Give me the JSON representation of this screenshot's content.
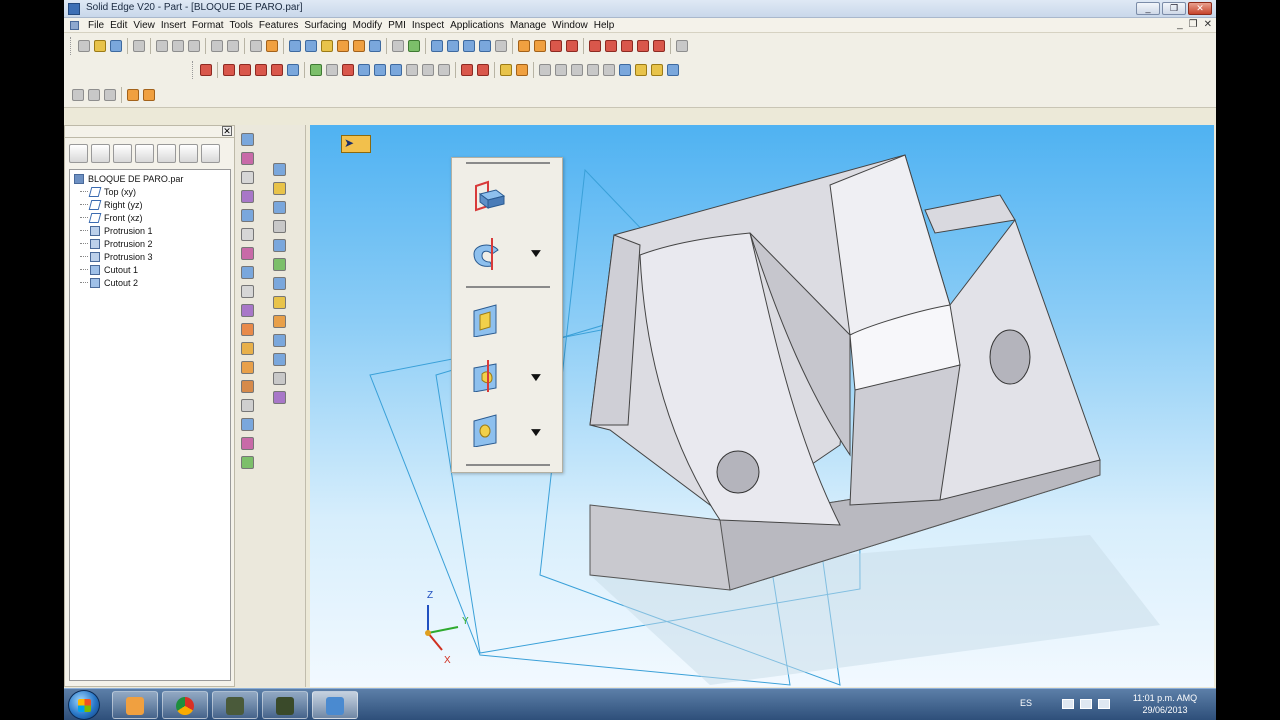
{
  "window": {
    "title": "Solid Edge V20 - Part - [BLOQUE DE PARO.par]",
    "minimize": "_",
    "restore": "❐",
    "close": "✕"
  },
  "menu": {
    "items": [
      "File",
      "Edit",
      "View",
      "Insert",
      "Format",
      "Tools",
      "Features",
      "Surfacing",
      "Modify",
      "PMI",
      "Inspect",
      "Applications",
      "Manage",
      "Window",
      "Help"
    ],
    "mdi_controls": [
      "_",
      "❐",
      "✕"
    ]
  },
  "pathfinder": {
    "close_glyph": "✕",
    "root": "BLOQUE DE PARO.par",
    "items": [
      {
        "label": "Top (xy)",
        "icon": "plane-icon"
      },
      {
        "label": "Right (yz)",
        "icon": "plane-icon"
      },
      {
        "label": "Front (xz)",
        "icon": "plane-icon"
      },
      {
        "label": "Protrusion 1",
        "icon": "protrusion-icon"
      },
      {
        "label": "Protrusion 2",
        "icon": "protrusion-icon"
      },
      {
        "label": "Protrusion 3",
        "icon": "protrusion-icon"
      },
      {
        "label": "Cutout 1",
        "icon": "cutout-icon"
      },
      {
        "label": "Cutout 2",
        "icon": "cutout-icon"
      }
    ]
  },
  "triad": {
    "x": "X",
    "y": "Y",
    "z": "Z"
  },
  "palette": {
    "carets": [
      "▼",
      "▼",
      "▼"
    ]
  },
  "taskbar": {
    "language": "ES",
    "time": "11:01 p.m. AMQ",
    "date": "29/06/2013"
  },
  "colors": {
    "viewport_top": "#4fb2f2",
    "viewport_bottom": "#f2f9ff",
    "part_face": "#e6e6ea",
    "plane_line": "#3aa0d8"
  }
}
